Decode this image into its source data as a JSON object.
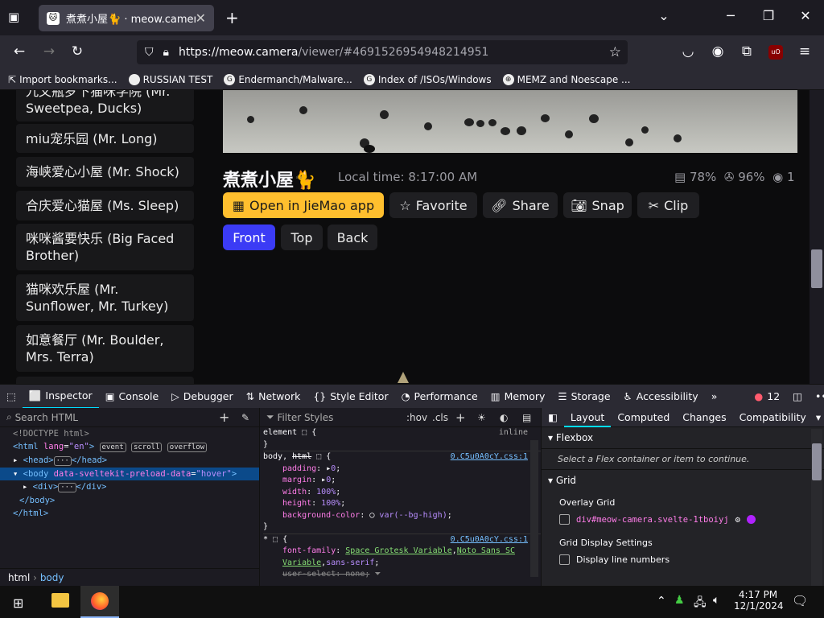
{
  "browser": {
    "tab_title": "煮煮小屋🐈 · meow.camera",
    "url_host": "https://meow.camera",
    "url_path": "/viewer/#4691526954948214951",
    "bookmarks": [
      "Import bookmarks...",
      "RUSSIAN TEST",
      "Endermanch/Malware...",
      "Index of /ISOs/Windows",
      "MEMZ and Noescape ..."
    ]
  },
  "sidebar": {
    "items": [
      "九文瓶罗下猫咪学院 (Mr. Sweetpea, Ducks)",
      "miu宠乐园 (Mr. Long)",
      "海峡爱心小屋 (Mr. Shock)",
      "合庆爱心猫屋 (Ms. Sleep)",
      "咪咪酱要快乐 (Big Faced Brother)",
      "猫咪欢乐屋 (Mr. Sunflower, Mr. Turkey)",
      "如意餐厅 (Mr. Boulder, Mrs. Terra)"
    ]
  },
  "viewer": {
    "title": "煮煮小屋🐈",
    "local_time": "Local time: 8:17:00 AM",
    "battery": "78%",
    "signal": "96%",
    "viewers": "1",
    "buttons": {
      "open_app": "Open in JieMao app",
      "favorite": "Favorite",
      "share": "Share",
      "snap": "Snap",
      "clip": "Clip",
      "front": "Front",
      "top": "Top",
      "back": "Back"
    }
  },
  "devtools": {
    "tabs": [
      "Inspector",
      "Console",
      "Debugger",
      "Network",
      "Style Editor",
      "Performance",
      "Memory",
      "Storage",
      "Accessibility"
    ],
    "error_count": "12",
    "search_html": "Search HTML",
    "filter_styles": "Filter Styles",
    "hov": ":hov",
    "cls": ".cls",
    "layout_tabs": [
      "Layout",
      "Computed",
      "Changes",
      "Compatibility"
    ],
    "flexbox": "Flexbox",
    "flex_hint": "Select a Flex container or item to continue.",
    "grid": "Grid",
    "overlay_grid": "Overlay Grid",
    "grid_item": "div#meow-camera.svelte-1tboiyj",
    "grid_display": "Grid Display Settings",
    "display_line_numbers": "Display line numbers",
    "breadcrumb": [
      "html",
      "body"
    ]
  },
  "taskbar": {
    "time": "4:17 PM",
    "date": "12/1/2024"
  }
}
